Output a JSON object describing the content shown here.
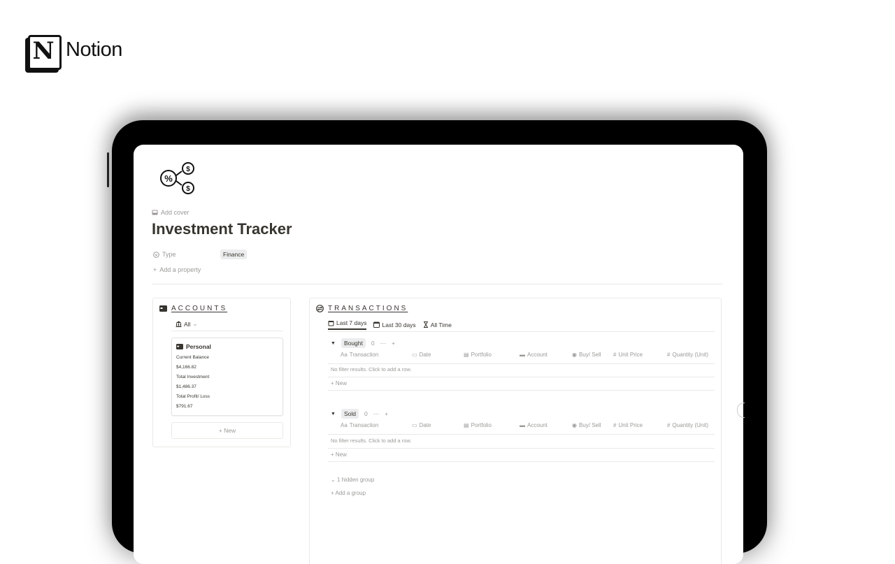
{
  "brand": {
    "name": "Notion"
  },
  "page": {
    "add_cover": "Add cover",
    "title": "Investment Tracker",
    "property": {
      "name": "Type",
      "value": "Finance"
    },
    "add_property": "Add a property"
  },
  "accounts": {
    "title": "ACCOUNTS",
    "view": "All",
    "card": {
      "name": "Personal",
      "current_balance_label": "Current Balance",
      "current_balance": "$4,166.82",
      "total_investment_label": "Total Investment",
      "total_investment": "$1,486.37",
      "total_pl_label": "Total Profit/ Loss",
      "total_pl": "$791.67"
    },
    "new_label": "+ New"
  },
  "transactions": {
    "title": "TRANSACTIONS",
    "tabs": [
      "Last 7 days",
      "Last 30 days",
      "All Time"
    ],
    "columns": [
      "Transaction",
      "Date",
      "Portfolio",
      "Account",
      "Buy/ Sell",
      "Unit Price",
      "Quantity (Unit)"
    ],
    "groups": [
      {
        "name": "Bought",
        "count": "0",
        "empty": "No filter results. Click to add a row.",
        "new": "+ New"
      },
      {
        "name": "Sold",
        "count": "0",
        "empty": "No filter results. Click to add a row.",
        "new": "+ New"
      }
    ],
    "hidden_group": "1 hidden group",
    "add_group": "+ Add a group"
  },
  "icons": {
    "page_icon": "percent-dollar-icon",
    "accounts": "wallet-icon",
    "transactions": "exchange-icon"
  }
}
